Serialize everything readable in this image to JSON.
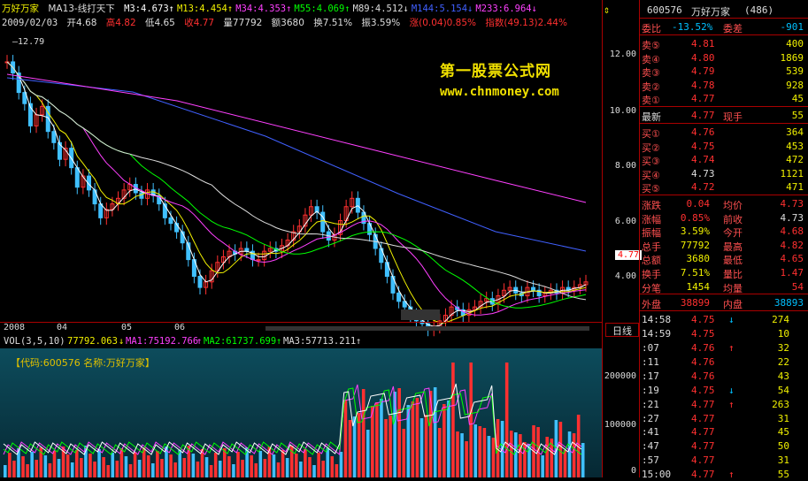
{
  "header": {
    "name": "万好万家",
    "indicator": "MA13-线打天下",
    "ma": [
      {
        "label": "M3:4.673",
        "arrow": "↑",
        "color": "#ffffff"
      },
      {
        "label": "M13:4.454",
        "arrow": "↑",
        "color": "#f0f000"
      },
      {
        "label": "M34:4.353",
        "arrow": "↑",
        "color": "#ff40ff"
      },
      {
        "label": "M55:4.069",
        "arrow": "↑",
        "color": "#00ff00"
      },
      {
        "label": "M89:4.512",
        "arrow": "↓",
        "color": "#dddddd"
      },
      {
        "label": "M144:5.154",
        "arrow": "↓",
        "color": "#4060ff"
      },
      {
        "label": "M233:6.964",
        "arrow": "↓",
        "color": "#ff40ff"
      }
    ],
    "date": "2009/02/03",
    "open": "开4.68",
    "high": "高4.82",
    "low": "低4.65",
    "close": "收4.77",
    "volume": "量77792",
    "amount": "额3680",
    "turnover": "换7.51%",
    "amplitude": "振3.59%",
    "change": "涨(0.04)0.85%",
    "index": "指数(49.13)2.44%",
    "peak_label": "12.79"
  },
  "watermark": {
    "line1": "第一股票公式网",
    "line2": "www.chnmoney.com"
  },
  "price_axis": [
    "12.00",
    "10.00",
    "8.00",
    "6.00",
    "4.00"
  ],
  "current_price_tag": "4.77",
  "date_labels": [
    "2008",
    "04",
    "05",
    "06"
  ],
  "vol_header": {
    "name": "VOL(3,5,10)",
    "value": "77792.063",
    "arrow": "↓",
    "ma1": "MA1:75192.766",
    "ma1_arrow": "↑",
    "ma2": "MA2:61737.699",
    "ma2_arrow": "↑",
    "ma3": "MA3:57713.211",
    "ma3_arrow": "↑"
  },
  "vol_info": "【代码:600576 名称:万好万家】",
  "vol_axis": [
    "200000",
    "100000",
    "0"
  ],
  "day_button": "日线",
  "panel": {
    "code": "600576",
    "name": "万好万家",
    "count": "(486)",
    "ratio_label": "委比",
    "ratio": "-13.52%",
    "diff_label": "委差",
    "diff": "-901",
    "asks": [
      {
        "label": "卖⑤",
        "price": "4.81",
        "vol": "400"
      },
      {
        "label": "卖④",
        "price": "4.80",
        "vol": "1869"
      },
      {
        "label": "卖③",
        "price": "4.79",
        "vol": "539"
      },
      {
        "label": "卖②",
        "price": "4.78",
        "vol": "928"
      },
      {
        "label": "卖①",
        "price": "4.77",
        "vol": "45"
      }
    ],
    "last_label": "最新",
    "last": "4.77",
    "hand_label": "现手",
    "hand": "55",
    "bids": [
      {
        "label": "买①",
        "price": "4.76",
        "vol": "364"
      },
      {
        "label": "买②",
        "price": "4.75",
        "vol": "453"
      },
      {
        "label": "买③",
        "price": "4.74",
        "vol": "472"
      },
      {
        "label": "买④",
        "price": "4.73",
        "vol": "1121"
      },
      {
        "label": "买⑤",
        "price": "4.72",
        "vol": "471"
      }
    ],
    "stats": [
      {
        "l1": "涨跌",
        "v1": "0.04",
        "l2": "均价",
        "v2": "4.73"
      },
      {
        "l1": "涨幅",
        "v1": "0.85%",
        "l2": "前收",
        "v2": "4.73"
      },
      {
        "l1": "振幅",
        "v1": "3.59%",
        "l2": "今开",
        "v2": "4.68"
      },
      {
        "l1": "总手",
        "v1": "77792",
        "l2": "最高",
        "v2": "4.82"
      },
      {
        "l1": "总额",
        "v1": "3680",
        "l2": "最低",
        "v2": "4.65"
      },
      {
        "l1": "换手",
        "v1": "7.51%",
        "l2": "量比",
        "v2": "1.47"
      },
      {
        "l1": "分笔",
        "v1": "1454",
        "l2": "均量",
        "v2": "54"
      }
    ],
    "outer_label": "外盘",
    "outer": "38899",
    "inner_label": "内盘",
    "inner": "38893",
    "ticks": [
      {
        "time": "14:58",
        "price": "4.75",
        "arrow": "↓",
        "vol": "274"
      },
      {
        "time": "14:59",
        "price": "4.75",
        "arrow": "",
        "vol": "10"
      },
      {
        "time": ":07",
        "price": "4.76",
        "arrow": "↑",
        "vol": "32"
      },
      {
        "time": ":11",
        "price": "4.76",
        "arrow": "",
        "vol": "22"
      },
      {
        "time": ":17",
        "price": "4.76",
        "arrow": "",
        "vol": "43"
      },
      {
        "time": ":19",
        "price": "4.75",
        "arrow": "↓",
        "vol": "54"
      },
      {
        "time": ":21",
        "price": "4.77",
        "arrow": "↑",
        "vol": "263"
      },
      {
        "time": ":27",
        "price": "4.77",
        "arrow": "",
        "vol": "31"
      },
      {
        "time": ":41",
        "price": "4.77",
        "arrow": "",
        "vol": "45"
      },
      {
        "time": ":47",
        "price": "4.77",
        "arrow": "",
        "vol": "50"
      },
      {
        "time": ":57",
        "price": "4.77",
        "arrow": "",
        "vol": "31"
      },
      {
        "time": "15:00",
        "price": "4.77",
        "arrow": "↑",
        "vol": "55"
      }
    ]
  },
  "colors": {
    "up": "#ff3030",
    "down": "#00c0ff",
    "yellow": "#f0f000",
    "border": "#aa0000",
    "label": "#ff5050"
  }
}
